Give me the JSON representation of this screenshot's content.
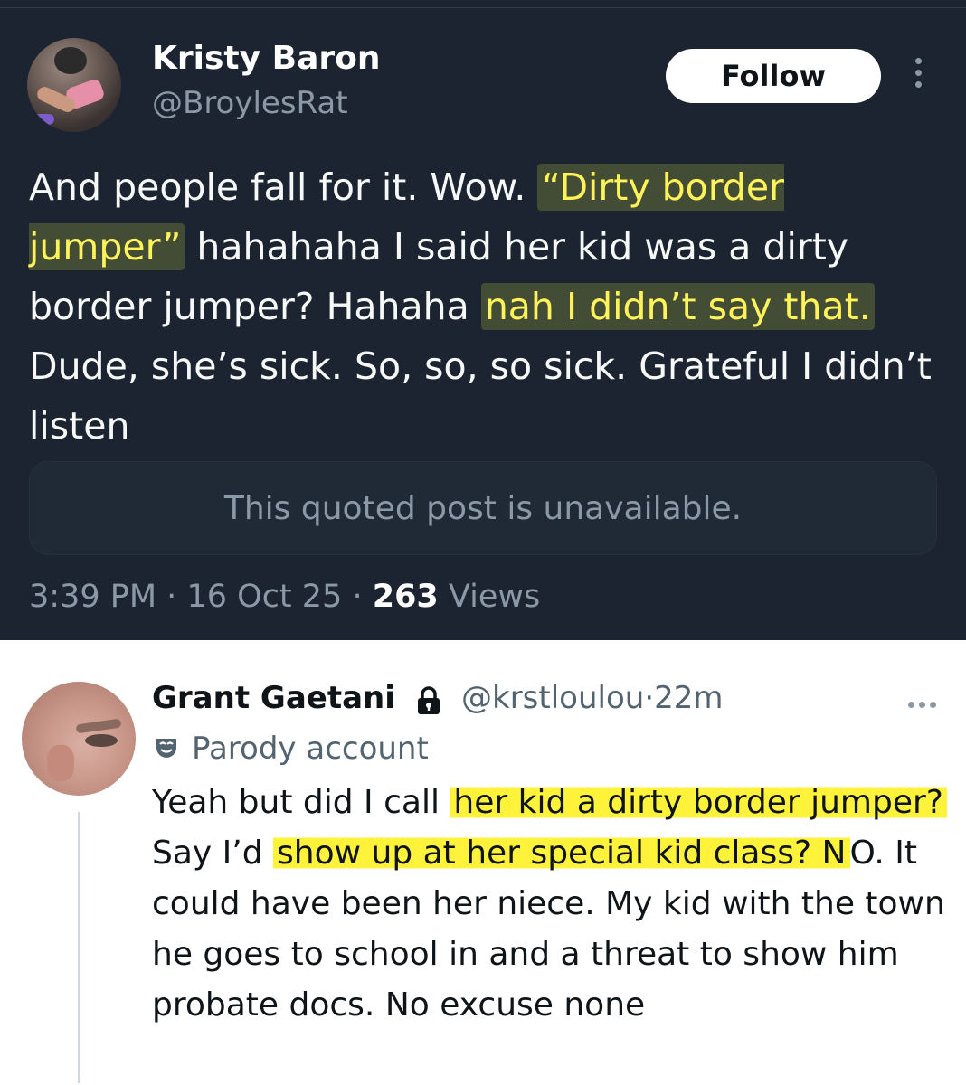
{
  "tweet": {
    "author_name": "Kristy Baron",
    "author_handle": "@BroylesRat",
    "follow_label": "Follow",
    "text_parts": {
      "p1": "And people fall for it. Wow. ",
      "h1": "“Dirty border jumper”",
      "p2": " hahahaha I said her kid was a dirty border jumper? Hahaha ",
      "h2": "nah I didn’t say that.",
      "p3": " Dude, she’s sick. So, so, so sick. Grateful I didn’t listen"
    },
    "quoted_unavailable": "This quoted post is unavailable.",
    "time": "3:39 PM",
    "date": "16 Oct 25",
    "views_count": "263",
    "views_label": "Views",
    "separator": "·"
  },
  "reply": {
    "author_name": "Grant Gaetani",
    "author_handle": "@krstloulou",
    "age": "22m",
    "separator": "·",
    "parody_label": "Parody account",
    "text_parts": {
      "p1": "Yeah but did I call ",
      "h1": "her kid a dirty border jumper?",
      "p2": " Say I’d ",
      "h2": "show up at her special kid class? N",
      "p3": "O. It could have been her niece. My kid with the town he goes to school in and a threat to show him probate docs. No excuse none"
    }
  },
  "icons": {
    "more": "more-options-icon",
    "lock": "lock-icon",
    "parody": "theater-mask-icon"
  },
  "colors": {
    "dark_bg": "#1b2430",
    "highlight_dark": "#fff35a",
    "highlight_light": "#fff23a"
  }
}
